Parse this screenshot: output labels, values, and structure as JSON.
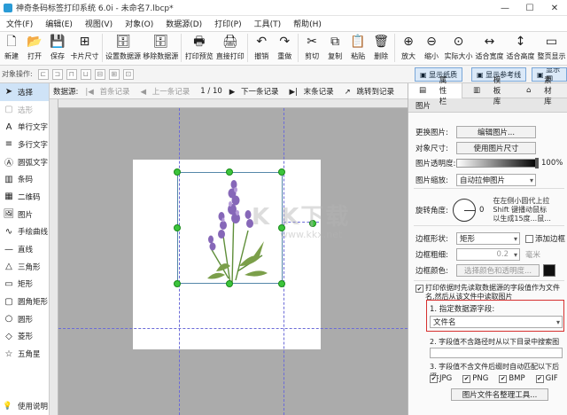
{
  "window": {
    "title": "神奇条码标签打印系统 6.0i - 未命名7.lbcp*",
    "min": "—",
    "max": "☐",
    "close": "✕"
  },
  "menu": [
    "文件(F)",
    "编辑(E)",
    "视图(V)",
    "对象(O)",
    "数据源(D)",
    "打印(P)",
    "工具(T)",
    "帮助(H)"
  ],
  "toolbar": [
    {
      "label": "新建",
      "icon": "new-file-icon",
      "glyph": "🗋"
    },
    {
      "label": "打开",
      "icon": "open-folder-icon",
      "glyph": "📂"
    },
    {
      "label": "保存",
      "icon": "save-icon",
      "glyph": "💾"
    },
    {
      "label": "卡片尺寸",
      "icon": "card-size-icon",
      "glyph": "⊞"
    },
    {
      "label": "设置数据源",
      "icon": "set-datasource-icon",
      "glyph": "🗄"
    },
    {
      "label": "移除数据源",
      "icon": "remove-datasource-icon",
      "glyph": "🗄"
    },
    {
      "label": "打印预览",
      "icon": "print-preview-icon",
      "glyph": "🖶"
    },
    {
      "label": "直接打印",
      "icon": "print-icon",
      "glyph": "🖨"
    },
    {
      "label": "撤销",
      "icon": "undo-icon",
      "glyph": "↶"
    },
    {
      "label": "重做",
      "icon": "redo-icon",
      "glyph": "↷"
    },
    {
      "label": "剪切",
      "icon": "cut-icon",
      "glyph": "✂"
    },
    {
      "label": "复制",
      "icon": "copy-icon",
      "glyph": "⧉"
    },
    {
      "label": "粘贴",
      "icon": "paste-icon",
      "glyph": "📋"
    },
    {
      "label": "删除",
      "icon": "delete-icon",
      "glyph": "🗑"
    },
    {
      "label": "放大",
      "icon": "zoom-in-icon",
      "glyph": "⊕"
    },
    {
      "label": "缩小",
      "icon": "zoom-out-icon",
      "glyph": "⊖"
    },
    {
      "label": "实际大小",
      "icon": "actual-size-icon",
      "glyph": "⊙"
    },
    {
      "label": "适合宽度",
      "icon": "fit-width-icon",
      "glyph": "↔"
    },
    {
      "label": "适合高度",
      "icon": "fit-height-icon",
      "glyph": "↕"
    },
    {
      "label": "整页显示",
      "icon": "full-page-icon",
      "glyph": "▭"
    }
  ],
  "objbar": {
    "label": "对象操作:",
    "buttons": [
      "显示纸质",
      "显示参考线",
      "显示网"
    ]
  },
  "left_tools": [
    {
      "label": "选择",
      "icon": "select-arrow-icon",
      "glyph": "➤",
      "selected": true,
      "disabled": false
    },
    {
      "label": "选形",
      "icon": "shape-select-icon",
      "glyph": "▢",
      "selected": false,
      "disabled": true
    },
    {
      "label": "单行文字",
      "icon": "single-line-text-icon",
      "glyph": "A",
      "selected": false,
      "disabled": false
    },
    {
      "label": "多行文字",
      "icon": "multi-line-text-icon",
      "glyph": "≡",
      "selected": false,
      "disabled": false
    },
    {
      "label": "圆弧文字",
      "icon": "arc-text-icon",
      "glyph": "Ⓐ",
      "selected": false,
      "disabled": false
    },
    {
      "label": "条码",
      "icon": "barcode-icon",
      "glyph": "▥",
      "selected": false,
      "disabled": false
    },
    {
      "label": "二维码",
      "icon": "qrcode-icon",
      "glyph": "▦",
      "selected": false,
      "disabled": false
    },
    {
      "label": "图片",
      "icon": "image-icon",
      "glyph": "🖼",
      "selected": false,
      "disabled": false
    },
    {
      "label": "手绘曲线",
      "icon": "freehand-curve-icon",
      "glyph": "∿",
      "selected": false,
      "disabled": false
    },
    {
      "label": "直线",
      "icon": "line-icon",
      "glyph": "—",
      "selected": false,
      "disabled": false
    },
    {
      "label": "三角形",
      "icon": "triangle-icon",
      "glyph": "△",
      "selected": false,
      "disabled": false
    },
    {
      "label": "矩形",
      "icon": "rectangle-icon",
      "glyph": "▭",
      "selected": false,
      "disabled": false
    },
    {
      "label": "圆角矩形",
      "icon": "rounded-rectangle-icon",
      "glyph": "▢",
      "selected": false,
      "disabled": false
    },
    {
      "label": "圆形",
      "icon": "circle-icon",
      "glyph": "○",
      "selected": false,
      "disabled": false
    },
    {
      "label": "菱形",
      "icon": "diamond-icon",
      "glyph": "◇",
      "selected": false,
      "disabled": false
    },
    {
      "label": "五角星",
      "icon": "star-icon",
      "glyph": "☆",
      "selected": false,
      "disabled": false
    }
  ],
  "help": {
    "label": "使用说明",
    "icon": "help-bulb-icon",
    "glyph": "💡"
  },
  "nav": {
    "datasource_label": "数据源:",
    "first": "首条记录",
    "prev": "上一条记录",
    "page": "1 / 10",
    "next": "下一条记录",
    "last": "末条记录",
    "jump": "跳转到记录"
  },
  "watermark": {
    "main": "K K下载",
    "sub": "www.kkx.net"
  },
  "right": {
    "tabs": [
      "属性栏",
      "模板库",
      "素材库"
    ],
    "header": "图片",
    "change_image_label": "更换图片:",
    "change_image_btn": "编辑图片...",
    "object_size_label": "对象尺寸:",
    "object_size_btn": "使用图片尺寸",
    "opacity_label": "图片透明度:",
    "opacity_value": "100%",
    "opacity_fraction": 1.0,
    "scale_label": "图片缩放:",
    "scale_value": "自动拉伸图片",
    "rotate_label": "旋转角度:",
    "rotate_value": "0",
    "rotate_hint": "在左侧小圆...",
    "rotate_hint_lines": [
      "在左侧小圆代上拉",
      "Shift 键播动鼠标",
      "以生成15度...鼠..."
    ],
    "border_shape_label": "边框形状:",
    "border_shape_value": "矩形",
    "add_border_label": "添加边框",
    "border_width_label": "边框粗细:",
    "border_width_value": "0.2",
    "border_width_unit": "毫米",
    "border_color_label": "边框颜色:",
    "border_color_btn": "选择颜色和透明度...",
    "border_color": "#111111",
    "print_from_ds_label": "打印依据时先读取数据源的字段值作为文件名,然后从该文件中读取图片",
    "step1_label": "1. 指定数据源字段:",
    "step1_value": "文件名",
    "step2_label": "2. 字段值不含路径时从以下目录中搜索图片:",
    "step3_label": "3. 字段值不含文件后缀时自动匹配以下后缀:",
    "ext": [
      "JPG",
      "PNG",
      "BMP",
      "GIF"
    ],
    "rename_btn": "图片文件名整理工具..."
  },
  "colors": {
    "accent": "#2a9bd6",
    "handle": "#3cc43c",
    "highlight_box": "#d6302f",
    "canvas_bg": "#ababab",
    "guide": "#6b6bd8"
  }
}
